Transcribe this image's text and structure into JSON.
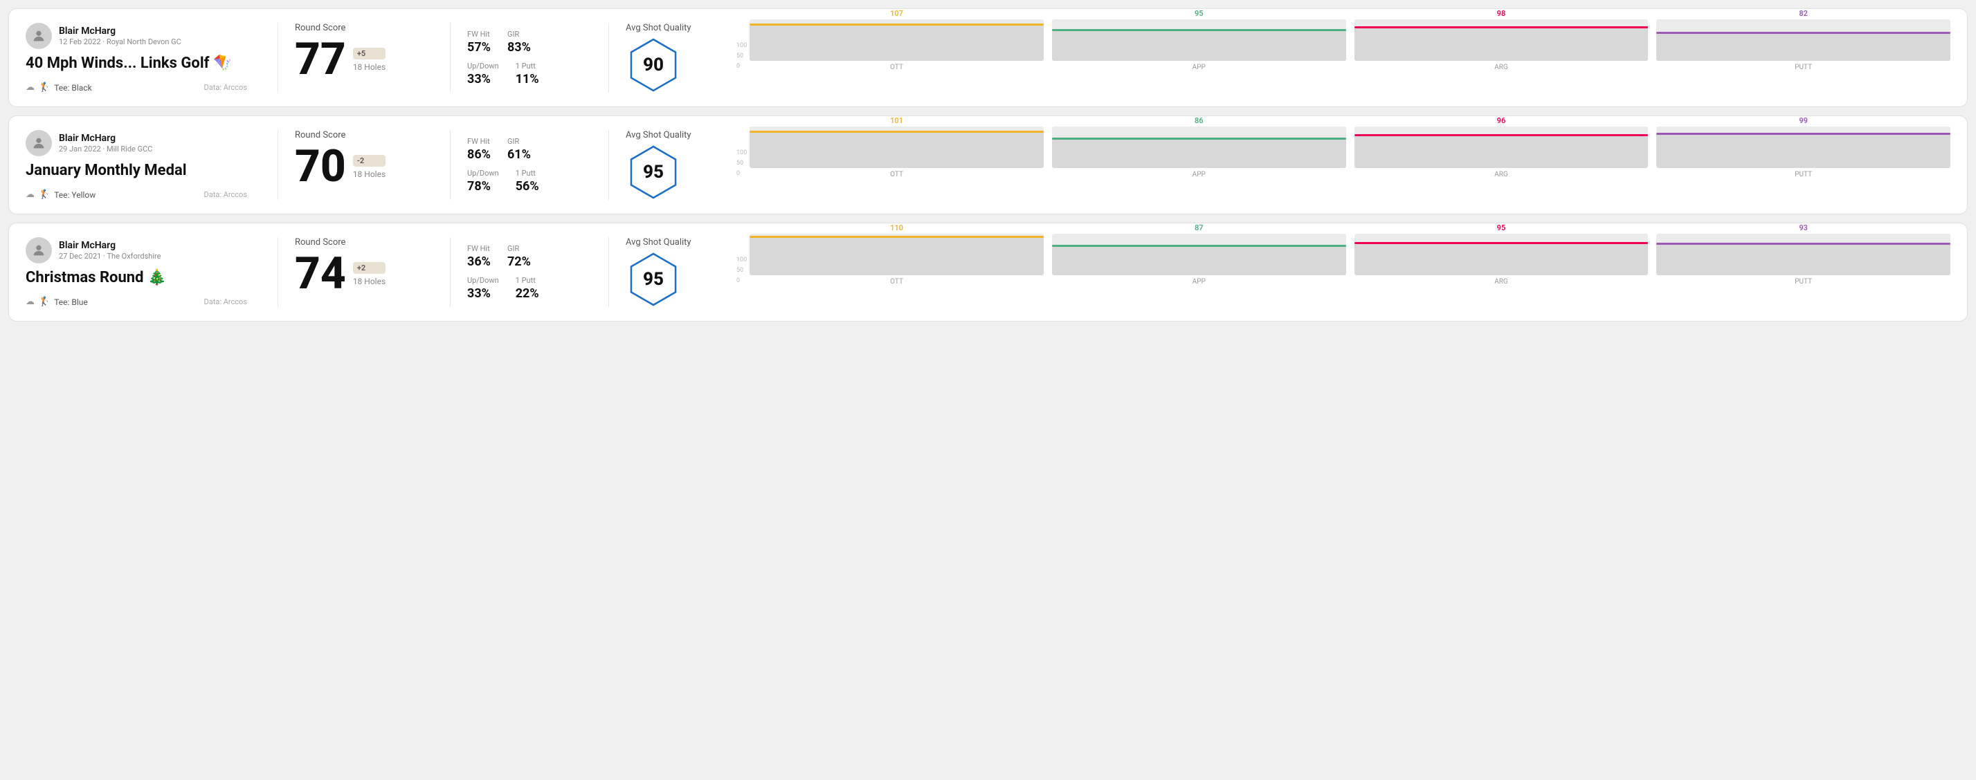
{
  "rounds": [
    {
      "id": "round1",
      "user": {
        "name": "Blair McHarg",
        "meta": "12 Feb 2022 · Royal North Devon GC"
      },
      "title": "40 Mph Winds... Links Golf 🪁",
      "tee": "Black",
      "data_source": "Data: Arccos",
      "score": 77,
      "score_diff": "+5",
      "holes": "18 Holes",
      "fw_hit": "57%",
      "gir": "83%",
      "up_down": "33%",
      "one_putt": "11%",
      "avg_shot_quality": 90,
      "chart": {
        "ott": {
          "value": 107,
          "color": "#f0b429",
          "bar_pct": 85
        },
        "app": {
          "value": 95,
          "color": "#4caf82",
          "bar_pct": 72
        },
        "arg": {
          "value": 98,
          "color": "#e05",
          "bar_pct": 78
        },
        "putt": {
          "value": 82,
          "color": "#9b59b6",
          "bar_pct": 65
        }
      }
    },
    {
      "id": "round2",
      "user": {
        "name": "Blair McHarg",
        "meta": "29 Jan 2022 · Mill Ride GCC"
      },
      "title": "January Monthly Medal",
      "tee": "Yellow",
      "data_source": "Data: Arccos",
      "score": 70,
      "score_diff": "-2",
      "holes": "18 Holes",
      "fw_hit": "86%",
      "gir": "61%",
      "up_down": "78%",
      "one_putt": "56%",
      "avg_shot_quality": 95,
      "chart": {
        "ott": {
          "value": 101,
          "color": "#f0b429",
          "bar_pct": 85
        },
        "app": {
          "value": 86,
          "color": "#4caf82",
          "bar_pct": 68
        },
        "arg": {
          "value": 96,
          "color": "#e05",
          "bar_pct": 76
        },
        "putt": {
          "value": 99,
          "color": "#9b59b6",
          "bar_pct": 80
        }
      }
    },
    {
      "id": "round3",
      "user": {
        "name": "Blair McHarg",
        "meta": "27 Dec 2021 · The Oxfordshire"
      },
      "title": "Christmas Round 🎄",
      "tee": "Blue",
      "data_source": "Data: Arccos",
      "score": 74,
      "score_diff": "+2",
      "holes": "18 Holes",
      "fw_hit": "36%",
      "gir": "72%",
      "up_down": "33%",
      "one_putt": "22%",
      "avg_shot_quality": 95,
      "chart": {
        "ott": {
          "value": 110,
          "color": "#f0b429",
          "bar_pct": 90
        },
        "app": {
          "value": 87,
          "color": "#4caf82",
          "bar_pct": 68
        },
        "arg": {
          "value": 95,
          "color": "#e05",
          "bar_pct": 75
        },
        "putt": {
          "value": 93,
          "color": "#9b59b6",
          "bar_pct": 74
        }
      }
    }
  ],
  "labels": {
    "round_score": "Round Score",
    "fw_hit": "FW Hit",
    "gir": "GIR",
    "up_down": "Up/Down",
    "one_putt": "1 Putt",
    "avg_shot_quality": "Avg Shot Quality",
    "ott": "OTT",
    "app": "APP",
    "arg": "ARG",
    "putt": "PUTT",
    "tee_prefix": "Tee:",
    "chart_100": "100",
    "chart_50": "50",
    "chart_0": "0"
  }
}
